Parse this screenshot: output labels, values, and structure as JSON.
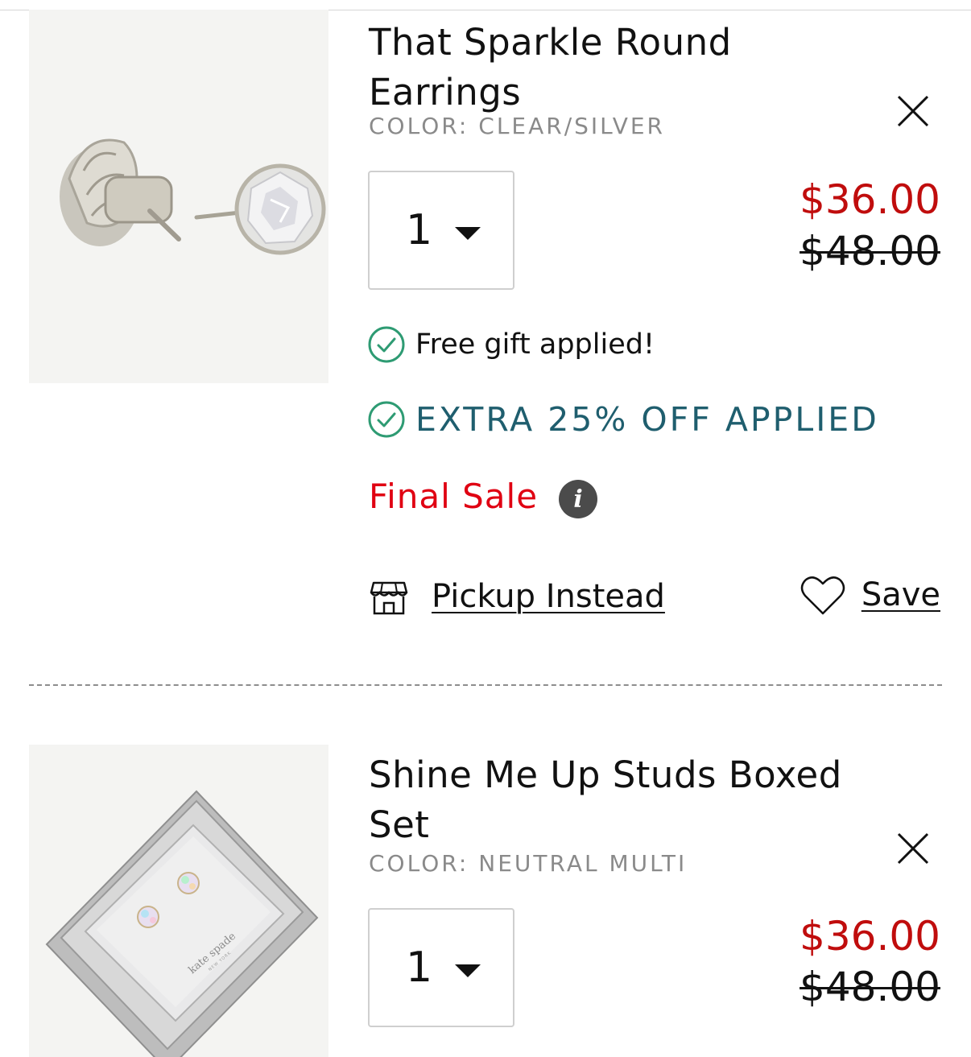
{
  "cart": {
    "items": [
      {
        "title": "That Sparkle Round Earrings",
        "color_label": "COLOR:",
        "color_value": "CLEAR/SILVER",
        "quantity": "1",
        "sale_price": "$36.00",
        "original_price": "$48.00",
        "image": "sparkle-round-earrings",
        "promo_gift": "Free gift applied!",
        "promo_extra": "EXTRA 25% OFF APPLIED",
        "final_sale": "Final Sale",
        "pickup_label": "Pickup Instead",
        "save_label": "Save"
      },
      {
        "title": "Shine Me Up Studs Boxed Set",
        "color_label": "COLOR:",
        "color_value": "NEUTRAL MULTI",
        "quantity": "1",
        "sale_price": "$36.00",
        "original_price": "$48.00",
        "image": "shine-me-up-studs-boxed-set",
        "box_brand": "kate spade",
        "box_sub": "NEW YORK"
      }
    ]
  },
  "colors": {
    "sale": "#c00d0d",
    "final_sale": "#e00012",
    "promo": "#1f5e6e",
    "check": "#2e9b73"
  },
  "icons": {
    "remove": "close-icon",
    "quantity": "caret-down-icon",
    "promo": "check-circle-icon",
    "info": "info-icon",
    "pickup": "store-icon",
    "save": "heart-icon"
  }
}
